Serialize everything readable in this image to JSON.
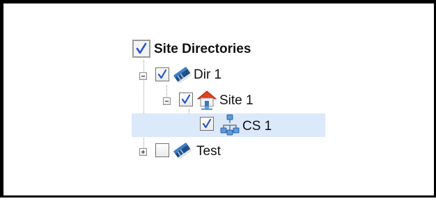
{
  "tree": {
    "root": {
      "label": "Site Directories",
      "checked": true
    },
    "nodes": [
      {
        "label": "Dir 1",
        "checked": true,
        "expanded": true,
        "icon": "book-icon"
      },
      {
        "label": "Site 1",
        "checked": true,
        "expanded": true,
        "icon": "house-icon"
      },
      {
        "label": "CS 1",
        "checked": true,
        "selected": true,
        "icon": "network-icon"
      },
      {
        "label": "Test",
        "checked": false,
        "expanded": false,
        "icon": "book-icon"
      }
    ]
  },
  "colors": {
    "selection": "#dce9fb",
    "checkmark": "#2255cc",
    "book": "#1e4f86"
  }
}
